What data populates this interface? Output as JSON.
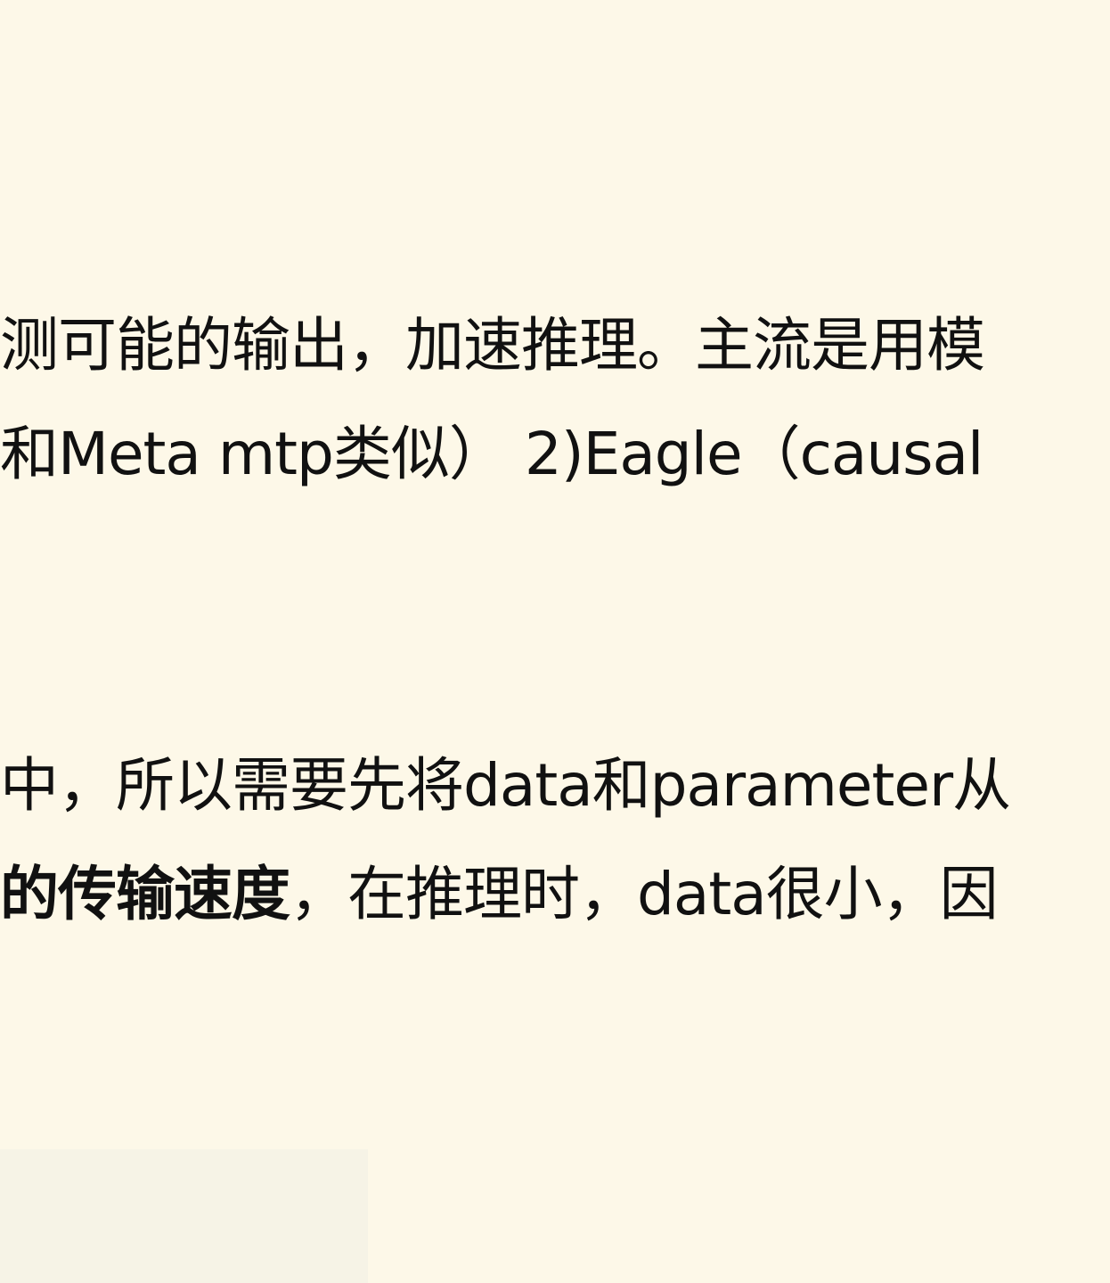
{
  "paragraph_1": {
    "line_1": "测可能的输出，加速推理。主流是用模",
    "line_2": "和Meta mtp类似） 2)Eagle（causal"
  },
  "paragraph_2": {
    "line_1": "中，所以需要先将data和parameter从",
    "line_2_bold": "的传输速度",
    "line_2_rest": "，在推理时，data很小，因"
  }
}
